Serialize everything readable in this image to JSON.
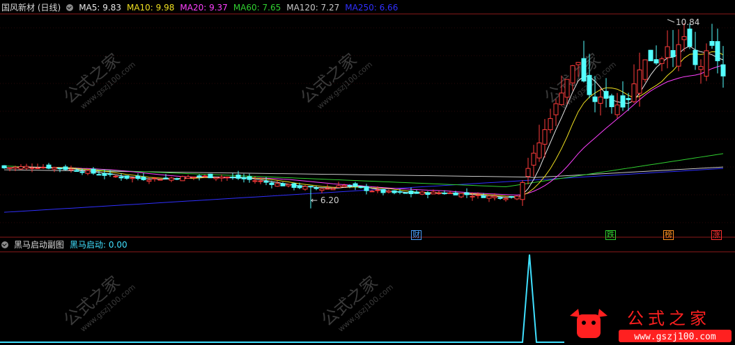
{
  "main_header": {
    "title": "国风新材 (日线)",
    "ma": [
      {
        "label": "MA5: 9.83",
        "color": "#e8e8e8"
      },
      {
        "label": "MA10: 9.98",
        "color": "#f0e020"
      },
      {
        "label": "MA20: 9.37",
        "color": "#ff40ff"
      },
      {
        "label": "MA60: 7.65",
        "color": "#30d030"
      },
      {
        "label": "MA120: 7.27",
        "color": "#c8c8c8"
      },
      {
        "label": "MA250: 6.66",
        "color": "#3030ff"
      }
    ]
  },
  "sub_header": {
    "title": "黑马启动副图",
    "indicator": "黑马启动: 0.00",
    "indicator_color": "#40e0ff"
  },
  "annotations": {
    "high": "10.84",
    "low": "6.20"
  },
  "badges": [
    {
      "text": "财",
      "color": "#4aa0ff"
    },
    {
      "text": "跌",
      "color": "#30d030"
    },
    {
      "text": "榜",
      "color": "#ff9020"
    },
    {
      "text": "涨",
      "color": "#ff3030"
    }
  ],
  "watermark": {
    "text": "公式之家",
    "url": "www.gszj100.com"
  },
  "logo": {
    "text": "公式之家",
    "url": "www.gszj100.com"
  },
  "colors": {
    "up": "#ff3c3c",
    "down": "#54ffff",
    "bg": "#000000"
  }
}
